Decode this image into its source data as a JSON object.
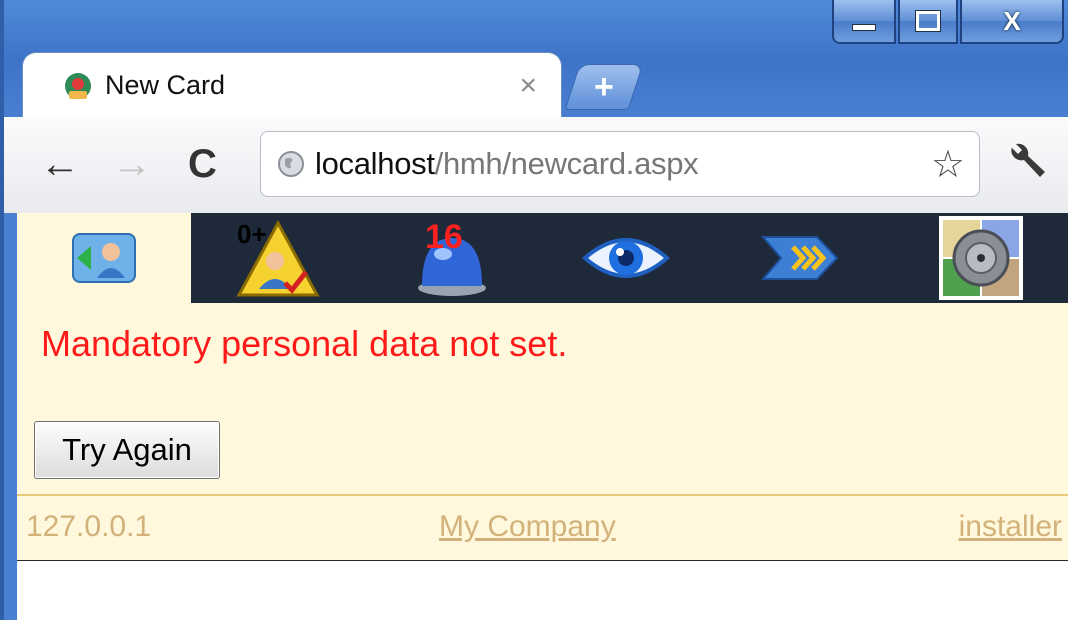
{
  "window": {
    "controls": {
      "minimize": "—",
      "maximize": "□",
      "close": "X"
    }
  },
  "tab": {
    "title": "New Card",
    "close": "×",
    "new_tab": "+"
  },
  "toolbar": {
    "back": "←",
    "forward": "→",
    "reload": "C",
    "url_host": "localhost",
    "url_path": "/hmh/newcard.aspx",
    "star": "☆"
  },
  "navbar": {
    "items": [
      {
        "icon": "contact-card-icon"
      },
      {
        "icon": "warning-user-icon",
        "badge": "0+"
      },
      {
        "icon": "blue-alarm-icon",
        "badge": "16"
      },
      {
        "icon": "eye-icon"
      },
      {
        "icon": "forward-arrows-icon"
      },
      {
        "icon": "settings-tile-icon"
      }
    ]
  },
  "content": {
    "error_message": "Mandatory personal data not set.",
    "try_again_label": "Try Again"
  },
  "footer": {
    "ip": "127.0.0.1",
    "company": "My Company",
    "user": "installer"
  }
}
